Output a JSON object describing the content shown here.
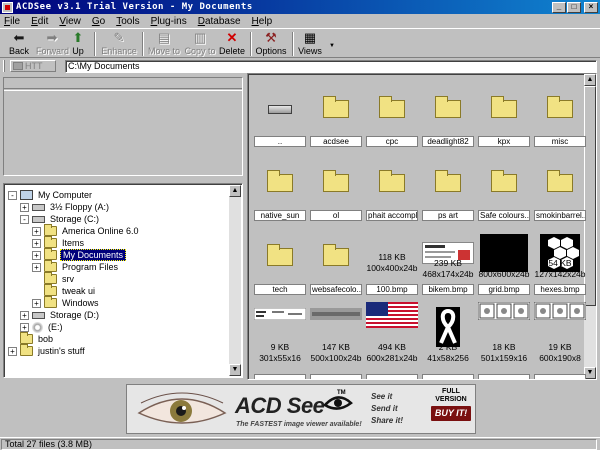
{
  "window": {
    "title": "ACDSee v3.1 Trial Version - My Documents"
  },
  "menu": [
    "File",
    "Edit",
    "View",
    "Go",
    "Tools",
    "Plug-ins",
    "Database",
    "Help"
  ],
  "toolbar": {
    "back": "Back",
    "forward": "Forward",
    "up": "Up",
    "enhance": "Enhance",
    "move_to": "Move to",
    "copy_to": "Copy to",
    "delete": "Delete",
    "options": "Options",
    "views": "Views"
  },
  "address": {
    "up_label": "HTT",
    "path": "C:\\My Documents"
  },
  "tree": [
    {
      "label": "My Computer",
      "icon": "computer-icon",
      "exp": "-",
      "indent": 0
    },
    {
      "label": "3½ Floppy (A:)",
      "icon": "drive-icon",
      "exp": "+",
      "indent": 1
    },
    {
      "label": "Storage (C:)",
      "icon": "drive-icon",
      "exp": "-",
      "indent": 1
    },
    {
      "label": "America Online 6.0",
      "icon": "folder-icon",
      "exp": "+",
      "indent": 2
    },
    {
      "label": "Items",
      "icon": "folder-icon",
      "exp": "+",
      "indent": 2
    },
    {
      "label": "My Documents",
      "icon": "folder-icon",
      "exp": "+",
      "indent": 2,
      "selected": true
    },
    {
      "label": "Program Files",
      "icon": "folder-icon",
      "exp": "+",
      "indent": 2
    },
    {
      "label": "srv",
      "icon": "folder-icon",
      "exp": "",
      "indent": 2
    },
    {
      "label": "tweak ui",
      "icon": "folder-icon",
      "exp": "",
      "indent": 2
    },
    {
      "label": "Windows",
      "icon": "folder-icon",
      "exp": "+",
      "indent": 2
    },
    {
      "label": "Storage (D:)",
      "icon": "drive-icon",
      "exp": "+",
      "indent": 1
    },
    {
      "label": "(E:)",
      "icon": "cd-icon",
      "exp": "+",
      "indent": 1
    },
    {
      "label": "bob",
      "icon": "folder-icon",
      "exp": "",
      "indent": 0
    },
    {
      "label": "justin's stuff",
      "icon": "folder-icon",
      "exp": "+",
      "indent": 0
    }
  ],
  "files": [
    {
      "name": "..",
      "kind": "parent"
    },
    {
      "name": "acdsee",
      "kind": "folder"
    },
    {
      "name": "cpc",
      "kind": "folder"
    },
    {
      "name": "deadlight82",
      "kind": "folder"
    },
    {
      "name": "kpx",
      "kind": "folder"
    },
    {
      "name": "misc",
      "kind": "folder"
    },
    {
      "name": "native_sun",
      "kind": "folder"
    },
    {
      "name": "ol",
      "kind": "folder"
    },
    {
      "name": "phait accompli",
      "kind": "folder"
    },
    {
      "name": "ps art",
      "kind": "folder"
    },
    {
      "name": "Safe colours...",
      "kind": "folder"
    },
    {
      "name": "smokinbarrel...",
      "kind": "folder"
    },
    {
      "name": "tech",
      "kind": "folder"
    },
    {
      "name": "websafecolo...",
      "kind": "folder"
    },
    {
      "name": "100.bmp",
      "kind": "bmp",
      "size": "118 KB",
      "dims": "100x400x24b",
      "thumb": "blank"
    },
    {
      "name": "bikem.bmp",
      "kind": "bmp",
      "size": "239 KB",
      "dims": "468x174x24b",
      "thumb": "form"
    },
    {
      "name": "grid.bmp",
      "kind": "bmp",
      "size": "1,407 KB",
      "dims": "800x600x24b",
      "thumb": "black"
    },
    {
      "name": "hexes.bmp",
      "kind": "bmp",
      "size": "54 KB",
      "dims": "127x142x24b",
      "thumb": "hex"
    },
    {
      "name": "",
      "kind": "bmp",
      "size": "9 KB",
      "dims": "301x55x16",
      "thumb": "small"
    },
    {
      "name": "",
      "kind": "bmp",
      "size": "147 KB",
      "dims": "500x100x24b",
      "thumb": "bar"
    },
    {
      "name": "",
      "kind": "bmp",
      "size": "494 KB",
      "dims": "600x281x24b",
      "thumb": "flag"
    },
    {
      "name": "",
      "kind": "bmp",
      "size": "2 KB",
      "dims": "41x58x256",
      "thumb": "ribbon"
    },
    {
      "name": "",
      "kind": "bmp",
      "size": "18 KB",
      "dims": "501x159x16",
      "thumb": "comic"
    },
    {
      "name": "",
      "kind": "bmp",
      "size": "19 KB",
      "dims": "600x190x8",
      "thumb": "comic"
    }
  ],
  "banner": {
    "brand": "ACD See",
    "tm": "TM",
    "tagline": "The FASTEST image viewer available!",
    "line1": "See it",
    "line2": "Send it",
    "line3": "Share it!",
    "full": "FULL",
    "version": "VERSION",
    "buy": "BUY IT!"
  },
  "status": {
    "text": "Total 27 files (3.8 MB)"
  },
  "colors": {
    "title_bar": "#00007b",
    "selection": "#00007b",
    "folder": "#f1e283"
  }
}
